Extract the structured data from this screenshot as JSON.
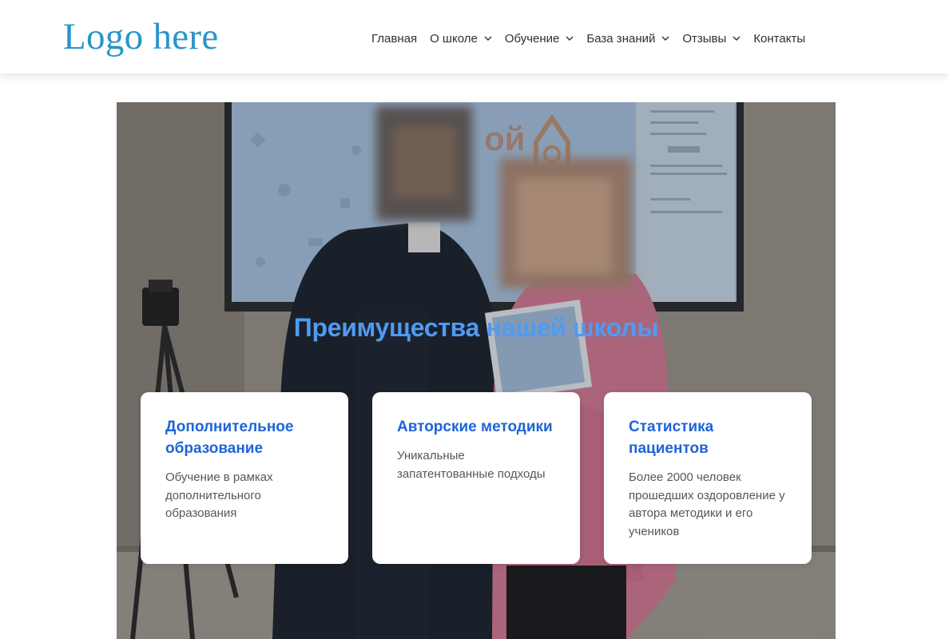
{
  "header": {
    "logo_text": "Logo here",
    "nav": [
      {
        "label": "Главная",
        "has_dropdown": false
      },
      {
        "label": "О школе",
        "has_dropdown": true
      },
      {
        "label": "Обучение",
        "has_dropdown": true
      },
      {
        "label": "База знаний",
        "has_dropdown": true
      },
      {
        "label": "Отзывы",
        "has_dropdown": true
      },
      {
        "label": "Контакты",
        "has_dropdown": false
      }
    ]
  },
  "hero": {
    "title": "Преимущества нашей школы",
    "cards": [
      {
        "title": "Дополнительное образование",
        "text": "Обучение в рамках дополнительного образования"
      },
      {
        "title": "Авторские методики",
        "text": "Уникальные запатентованные подходы"
      },
      {
        "title": "Статистика пациентов",
        "text": "Более 2000 человек прошедших оздоровление у автора методики и его учеников"
      }
    ]
  },
  "colors": {
    "logo": "#2b94c9",
    "hero_title": "#4f9bf2",
    "card_title": "#1f64d6",
    "card_text": "#53575d",
    "nav_text": "#2b3138"
  }
}
